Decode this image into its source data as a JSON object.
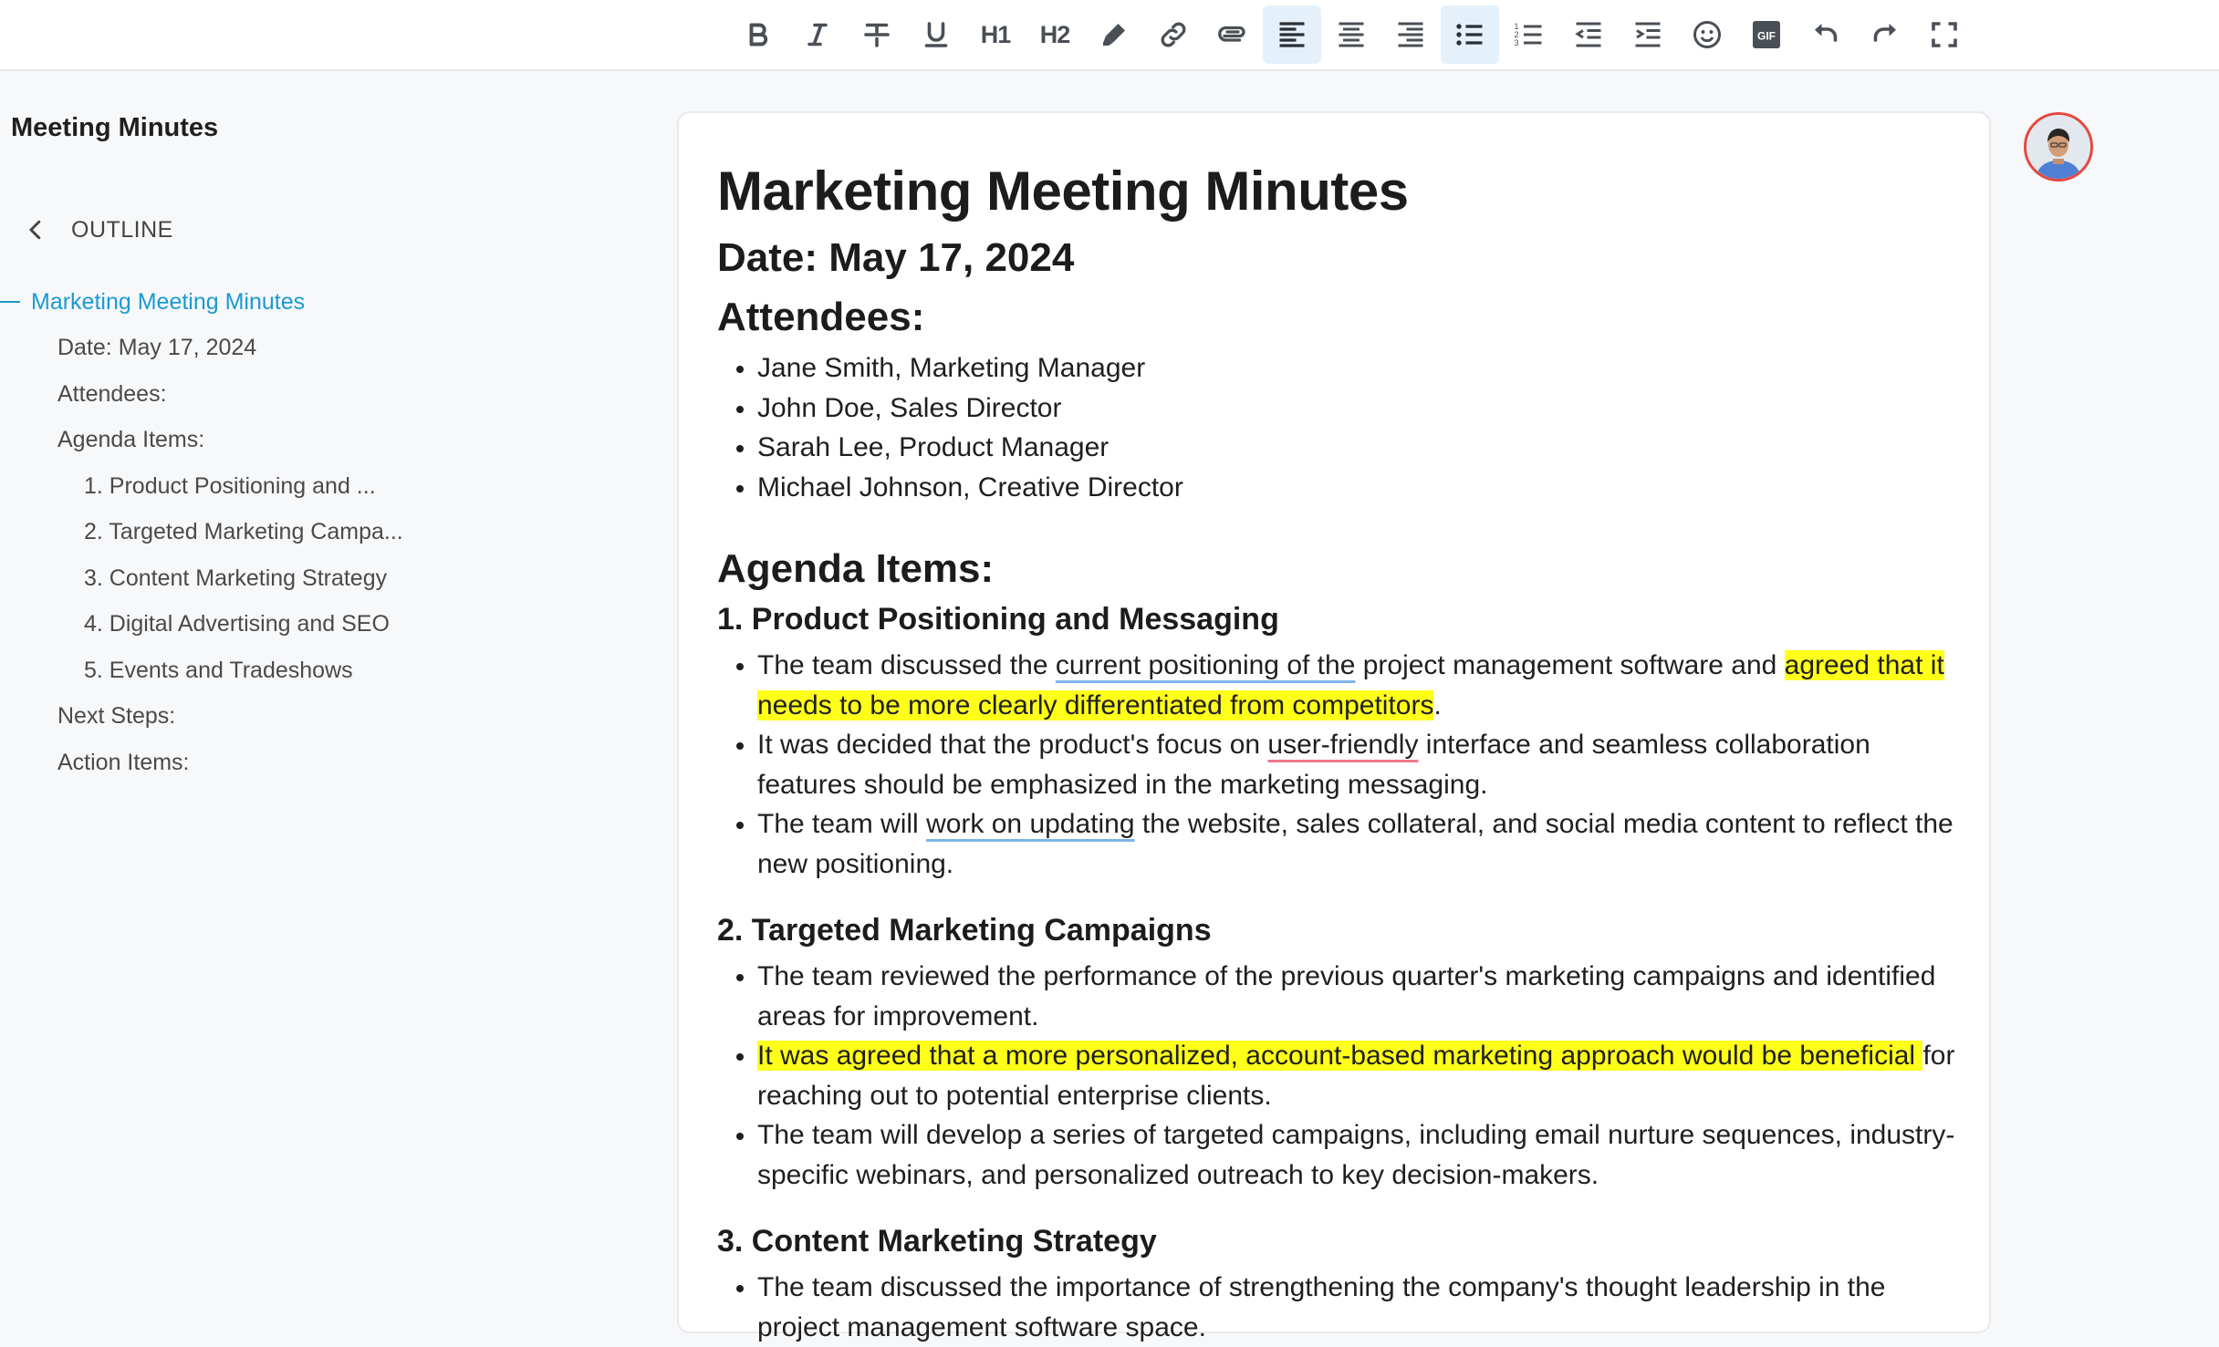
{
  "toolbar": {
    "h1_label": "H1",
    "h2_label": "H2",
    "gif_label": "GIF",
    "items": [
      "bold-icon",
      "italic-icon",
      "strikethrough-icon",
      "underline-icon",
      "h1",
      "h2",
      "highlight-pen-icon",
      "link-icon",
      "attachment-icon",
      "align-left-icon",
      "align-center-icon",
      "align-right-icon",
      "bullet-list-icon",
      "numbered-list-icon",
      "outdent-icon",
      "indent-icon",
      "emoji-icon",
      "gif-icon",
      "undo-icon",
      "redo-icon",
      "fullscreen-icon"
    ],
    "active": [
      "align-left-icon",
      "bullet-list-icon"
    ],
    "active_color": "#e4f1fb",
    "icon_color": "#4a4f56"
  },
  "sidebar": {
    "doc_title": "Meeting Minutes",
    "outline_label": "OUTLINE",
    "accent_color": "#1a9ad0",
    "outline": [
      {
        "label": "Marketing Meeting Minutes",
        "level": 0
      },
      {
        "label": "Date: May 17, 2024",
        "level": 1
      },
      {
        "label": "Attendees:",
        "level": 1
      },
      {
        "label": "Agenda Items:",
        "level": 1
      },
      {
        "label": "1. Product Positioning and ...",
        "level": 2
      },
      {
        "label": "2. Targeted Marketing Campa...",
        "level": 2
      },
      {
        "label": "3. Content Marketing Strategy",
        "level": 2
      },
      {
        "label": "4. Digital Advertising and SEO",
        "level": 2
      },
      {
        "label": "5. Events and Tradeshows",
        "level": 2
      },
      {
        "label": "Next Steps:",
        "level": 1
      },
      {
        "label": "Action Items:",
        "level": 1
      }
    ]
  },
  "doc": {
    "title": "Marketing Meeting Minutes",
    "date": "Date: May 17, 2024",
    "attendees_heading": "Attendees:",
    "attendees": [
      "Jane Smith, Marketing Manager",
      "John Doe, Sales Director",
      "Sarah Lee, Product Manager",
      "Michael Johnson, Creative Director"
    ],
    "agenda_heading": "Agenda Items:",
    "sec1": {
      "heading": "1. Product Positioning and Messaging",
      "b1": {
        "p1": "The team discussed the ",
        "p2": "current positioning of the",
        "p3": " project management software and ",
        "p4": "agreed that it needs to be more clearly differentiated from competitors",
        "p5": "."
      },
      "b2": {
        "p1": "It was decided that the product's focus on ",
        "p2": "user-friendly",
        "p3": " interface and seamless collaboration features should be emphasized in the marketing messaging."
      },
      "b3": {
        "p1": "The team will ",
        "p2": "work on updating",
        "p3": " the website, sales collateral, and social media content to reflect the new positioning."
      }
    },
    "sec2": {
      "heading": "2. Targeted Marketing Campaigns",
      "b1": "The team reviewed the performance of the previous quarter's marketing campaigns and identified areas for improvement.",
      "b2": {
        "p1": "It was agreed that a more personalized, account-based marketing approach would be beneficial ",
        "p2": "for reaching out to potential enterprise clients."
      },
      "b3": "The team will develop a series of targeted campaigns, including email nurture sequences, industry-specific webinars, and personalized outreach to key decision-makers."
    },
    "sec3": {
      "heading": "3. Content Marketing Strategy",
      "b1": "The team discussed the importance of strengthening the company's thought leadership in the project management software space."
    },
    "highlight_color": "#ffff1a"
  },
  "avatar": {
    "border_color": "#e5483e"
  }
}
